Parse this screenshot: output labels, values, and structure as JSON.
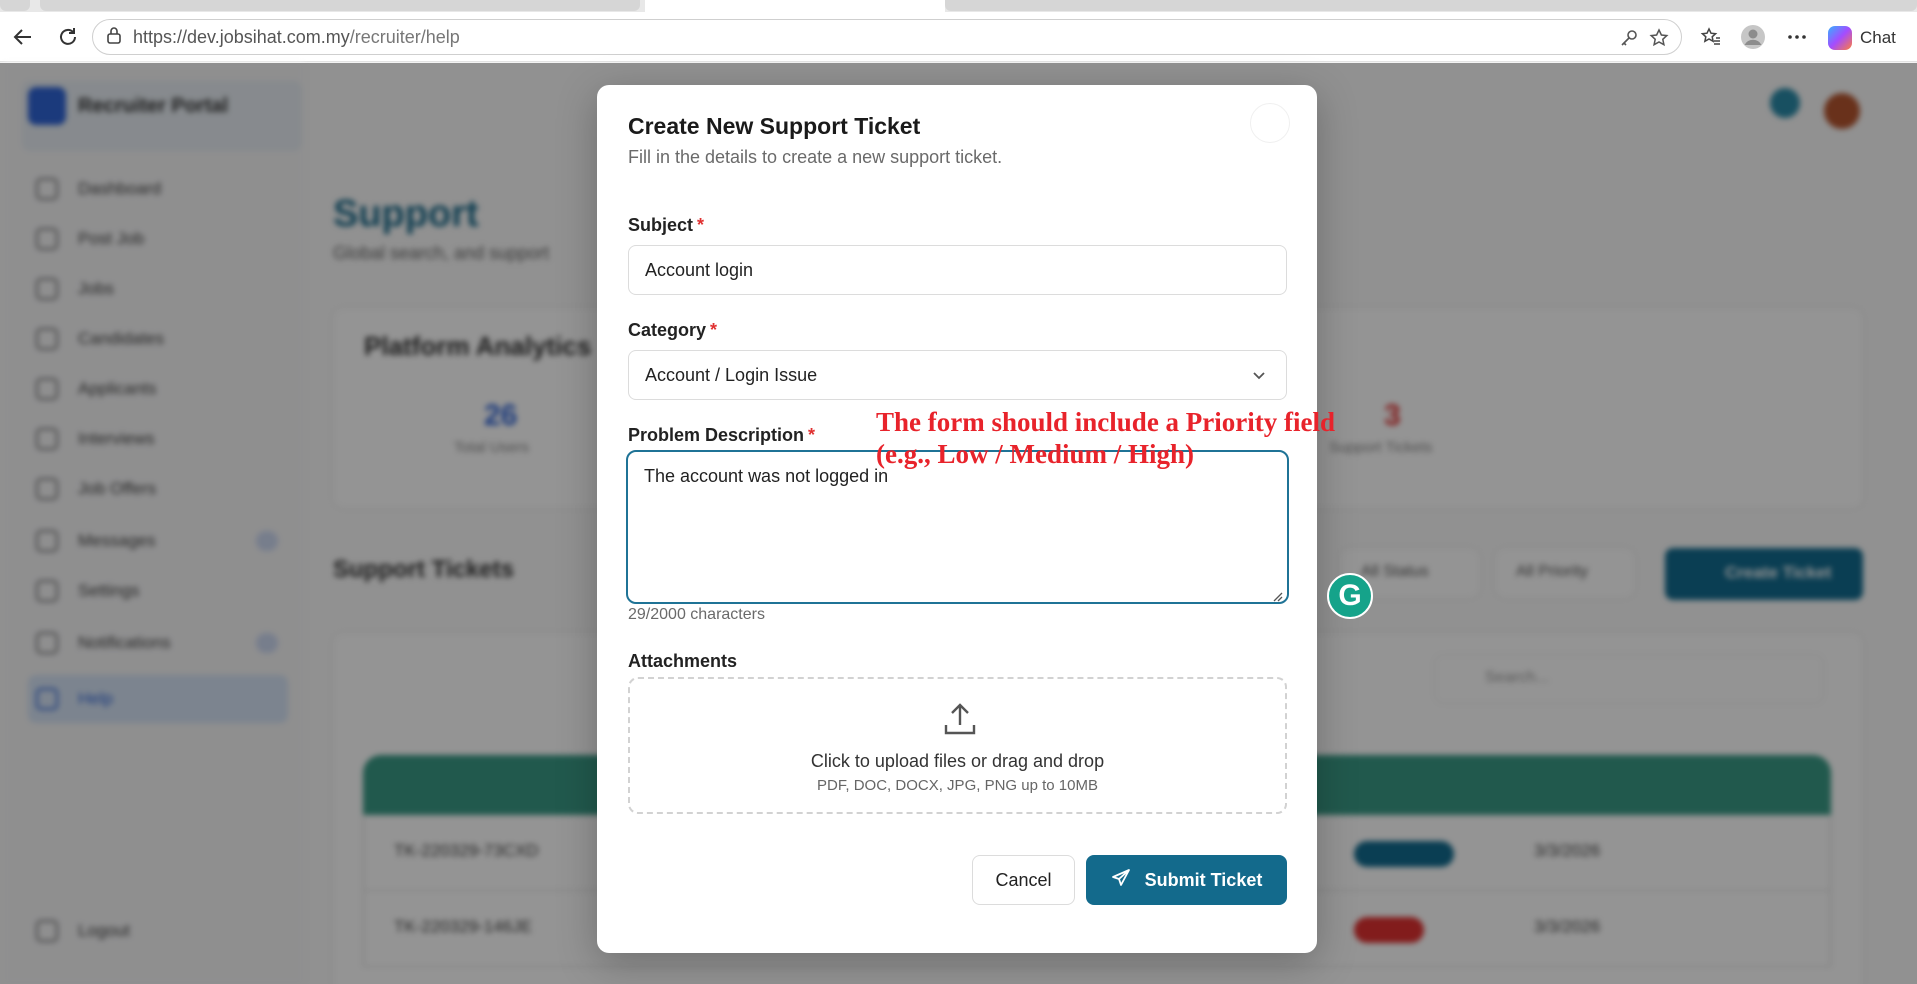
{
  "browser": {
    "url_host": "https://dev.jobsihat.com.my",
    "url_path": "/recruiter/help",
    "chat_label": "Chat"
  },
  "background": {
    "brand": "Recruiter Portal",
    "nav": [
      "Dashboard",
      "Post Job",
      "Jobs",
      "Candidates",
      "Applicants",
      "Interviews",
      "Job Offers",
      "Messages",
      "Settings",
      "Notifications",
      "Help"
    ],
    "logout": "Logout",
    "page_title": "Support",
    "page_subtitle": "Global search, and support",
    "analytics_title": "Platform Analytics",
    "stat_total": "26",
    "stat_total_label": "Total Users",
    "stat_tickets": "3",
    "stat_tickets_label": "Support Tickets",
    "section_title": "Support Tickets",
    "filter_status": "All Status",
    "filter_priority": "All Priority",
    "create_ticket": "Create Ticket",
    "search_placeholder": "Search...",
    "rows": [
      {
        "id": "TK-220329-73CXD",
        "date": "3/3/2026"
      },
      {
        "id": "TK-220329-146JE",
        "date": "3/3/2026"
      }
    ]
  },
  "modal": {
    "title": "Create New Support Ticket",
    "subtitle": "Fill in the details to create a new support ticket.",
    "subject_label": "Subject",
    "subject_value": "Account login",
    "category_label": "Category",
    "category_value": "Account / Login Issue",
    "description_label": "Problem Description",
    "description_value": "The account was not logged in",
    "char_counter": "29/2000 characters",
    "attachments_label": "Attachments",
    "upload_text": "Click to upload files or drag and drop",
    "upload_hint": "PDF, DOC, DOCX, JPG, PNG up to 10MB",
    "cancel_label": "Cancel",
    "submit_label": "Submit Ticket",
    "required_mark": "*"
  },
  "annotation": {
    "text": "The form should include a Priority field (e.g., Low / Medium / High)",
    "color": "#e8232b"
  },
  "colors": {
    "primary": "#136a8c",
    "required": "#e03131",
    "focus_border": "#1f7396"
  }
}
